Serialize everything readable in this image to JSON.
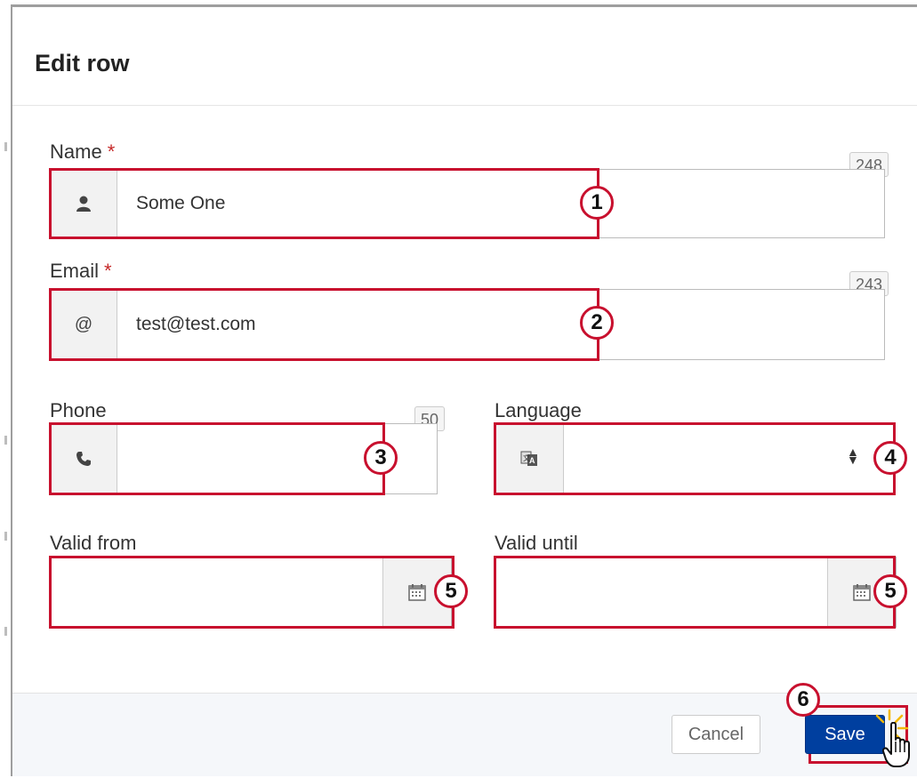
{
  "dialog": {
    "title": "Edit row"
  },
  "fields": {
    "name": {
      "label": "Name",
      "required_mark": "*",
      "value": "Some One",
      "counter": "248"
    },
    "email": {
      "label": "Email",
      "required_mark": "*",
      "value": "test@test.com",
      "counter": "243",
      "addon_text": "@"
    },
    "phone": {
      "label": "Phone",
      "value": "",
      "counter": "50"
    },
    "language": {
      "label": "Language",
      "value": ""
    },
    "valid_from": {
      "label": "Valid from",
      "value": ""
    },
    "valid_until": {
      "label": "Valid until",
      "value": ""
    }
  },
  "buttons": {
    "cancel": "Cancel",
    "save": "Save"
  },
  "callouts": [
    "1",
    "2",
    "3",
    "4",
    "5",
    "5",
    "6"
  ],
  "icons": {
    "name": "user-icon",
    "phone": "phone-icon",
    "language": "translate-icon",
    "calendar": "calendar-icon",
    "cursor": "hand-pointer-icon"
  },
  "colors": {
    "highlight": "#c8102e",
    "primary": "#003f9f",
    "required": "#c62828"
  }
}
